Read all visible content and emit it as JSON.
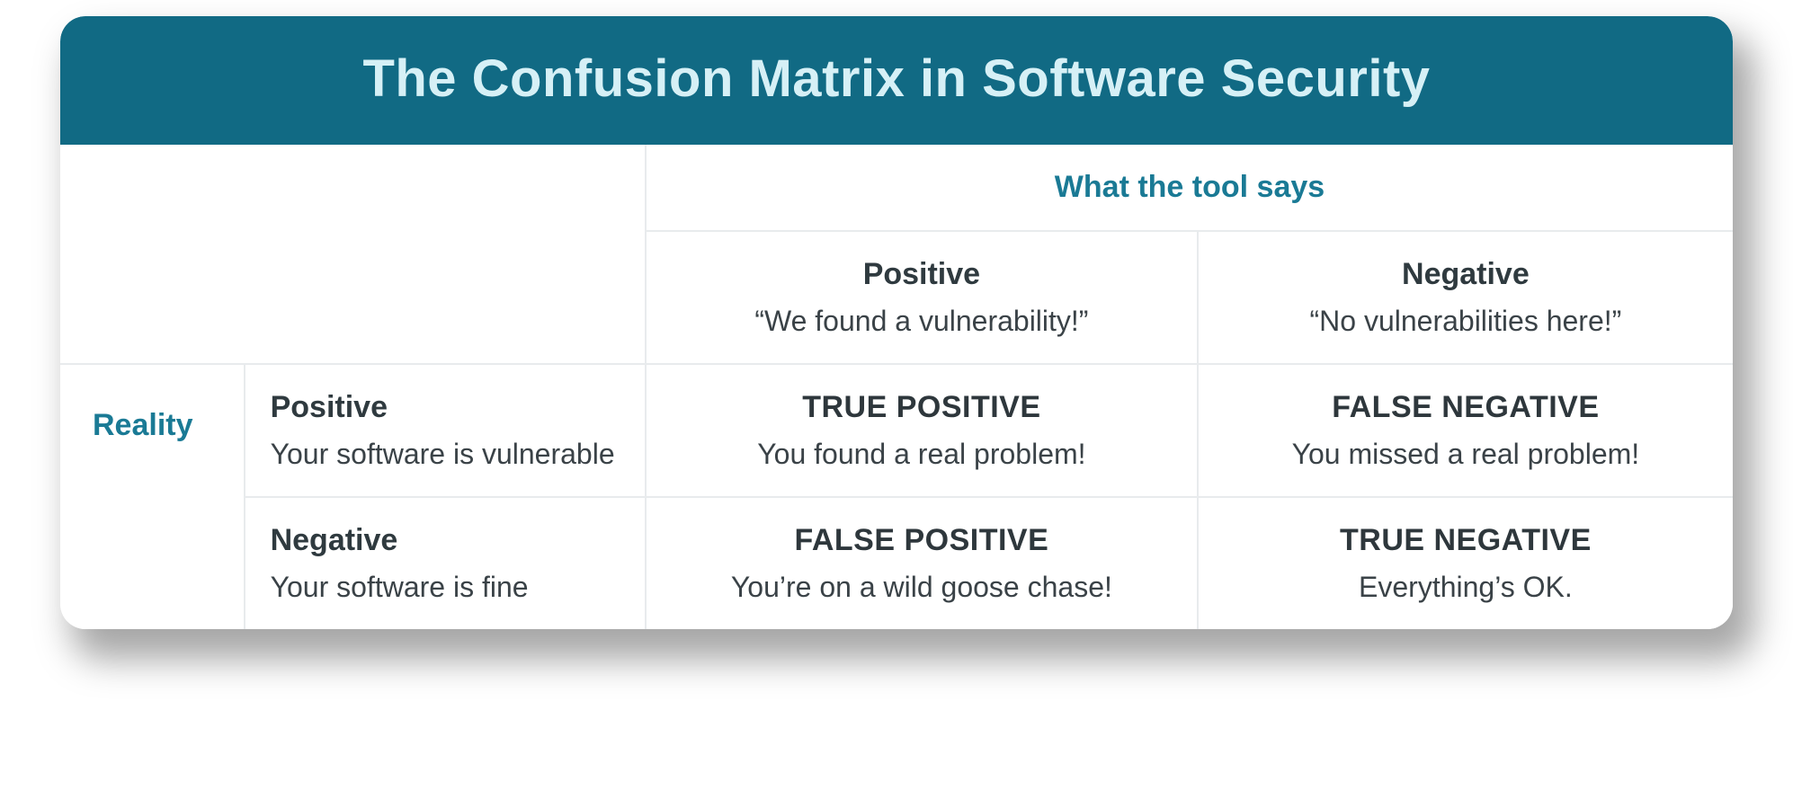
{
  "title": "The Confusion Matrix in Software Security",
  "axes": {
    "columns_title": "What the tool says",
    "rows_title": "Reality"
  },
  "columns": [
    {
      "label": "Positive",
      "sub": "“We found a vulnerability!”"
    },
    {
      "label": "Negative",
      "sub": "“No vulnerabilities here!”"
    }
  ],
  "rows": [
    {
      "label": "Positive",
      "sub": "Your software is vulnerable"
    },
    {
      "label": "Negative",
      "sub": "Your software is fine"
    }
  ],
  "cells": {
    "tp": {
      "title": "TRUE POSITIVE",
      "sub": "You found a real problem!"
    },
    "fn": {
      "title": "FALSE NEGATIVE",
      "sub": "You missed a real problem!"
    },
    "fp": {
      "title": "FALSE POSITIVE",
      "sub": "You’re on a wild goose chase!"
    },
    "tn": {
      "title": "TRUE NEGATIVE",
      "sub": "Everything’s OK."
    }
  },
  "colors": {
    "header_bg": "#116a84",
    "header_text": "#d6f0f6",
    "axis_text": "#1a7a95",
    "grid_line": "#e8ebed",
    "body_text": "#2f3a3f"
  }
}
